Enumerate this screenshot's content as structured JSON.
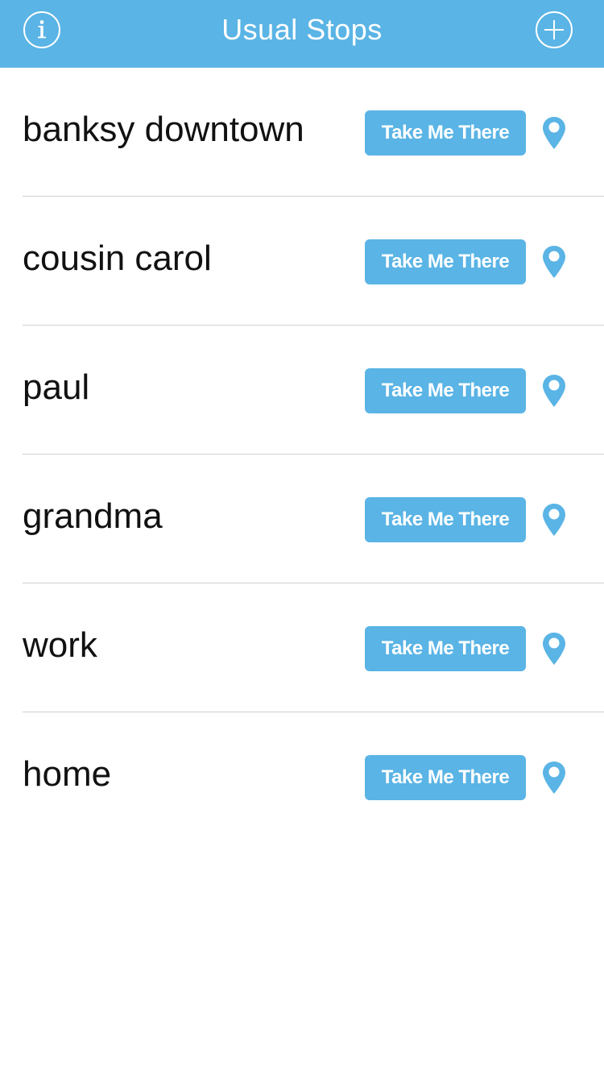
{
  "header": {
    "title": "Usual Stops",
    "info_icon": "info-icon",
    "add_icon": "plus-icon"
  },
  "colors": {
    "accent": "#5ab4e5",
    "divider": "#cfcfcf",
    "text": "#111111"
  },
  "stops": [
    {
      "name": "banksy downtown",
      "button_label": "Take Me There",
      "icon": "location-pin-icon"
    },
    {
      "name": "cousin carol",
      "button_label": "Take Me There",
      "icon": "location-pin-icon"
    },
    {
      "name": "paul",
      "button_label": "Take Me There",
      "icon": "location-pin-icon"
    },
    {
      "name": "grandma",
      "button_label": "Take Me There",
      "icon": "location-pin-icon"
    },
    {
      "name": "work",
      "button_label": "Take Me There",
      "icon": "location-pin-icon"
    },
    {
      "name": "home",
      "button_label": "Take Me There",
      "icon": "location-pin-icon"
    }
  ]
}
